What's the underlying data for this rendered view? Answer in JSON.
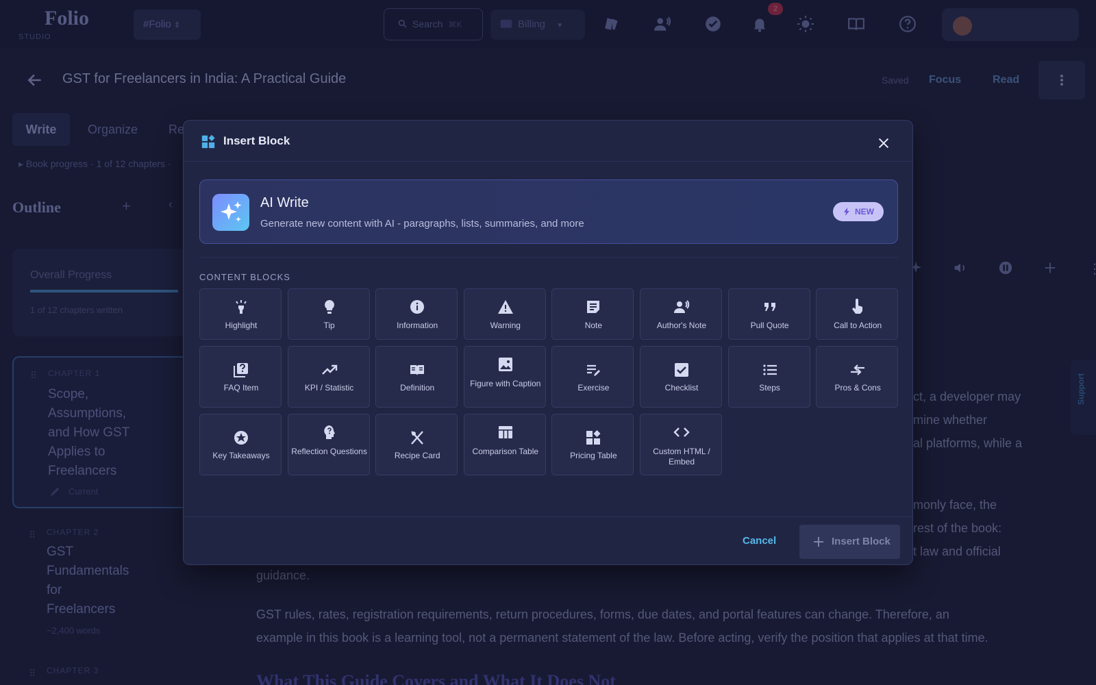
{
  "app": {
    "logo": "Folio",
    "logo_sub": "STUDIO",
    "workspace": "#Folio",
    "search_placeholder": "Search",
    "search_shortcut": "⌘K",
    "billing_label": "Billing",
    "notification_count": "2"
  },
  "doc": {
    "title": "GST for Freelancers in India: A Practical Guide",
    "saved": "Saved",
    "focus": "Focus",
    "read": "Read",
    "tabs": [
      "Write",
      "Organize",
      "Re"
    ],
    "book_progress": "▸ Book progress · 1 of 12 chapters ·"
  },
  "sidebar": {
    "outline_title": "Outline",
    "progress_label": "Overall Progress",
    "progress_fraction": 1.0,
    "progress_sub": "1 of 12 chapters written",
    "chapters": [
      {
        "kicker": "CHAPTER 1",
        "title": [
          "Scope,",
          "Assumptions,",
          "and How GST",
          "Applies to",
          "Freelancers"
        ],
        "meta": "Current"
      },
      {
        "kicker": "CHAPTER 2",
        "title": [
          "GST",
          "Fundamentals",
          "for",
          "Freelancers"
        ],
        "meta": "~2,400 words"
      },
      {
        "kicker": "CHAPTER 3",
        "title": [],
        "meta": ""
      }
    ]
  },
  "editor": {
    "frag1": "ct, a developer may",
    "frag2": "mine whether",
    "frag3": "al platforms, while a",
    "frag4": "monly face, the",
    "frag5": "rest of the book:",
    "frag6": "t law and official",
    "frag7": "guidance.",
    "para2_line1": "GST rules, rates, registration requirements, return procedures, forms, due dates, and portal features can change. Therefore, an",
    "para2_line2": "example in this book is a learning tool, not a permanent statement of the law. Before acting, verify the position that applies at that time.",
    "heading": "What This Guide Covers and What It Does Not",
    "support": "Support"
  },
  "modal": {
    "title": "Insert Block",
    "ai_title": "AI Write",
    "ai_desc": "Generate new content with AI - paragraphs, lists, summaries, and more",
    "new_badge": "NEW",
    "section_label": "CONTENT BLOCKS",
    "blocks": [
      {
        "label": "Highlight",
        "icon": "highlight-icon"
      },
      {
        "label": "Tip",
        "icon": "lightbulb-icon"
      },
      {
        "label": "Information",
        "icon": "info-icon"
      },
      {
        "label": "Warning",
        "icon": "warning-icon"
      },
      {
        "label": "Note",
        "icon": "note-icon"
      },
      {
        "label": "Author's Note",
        "icon": "speaker-icon"
      },
      {
        "label": "Pull Quote",
        "icon": "quote-icon"
      },
      {
        "label": "Call to Action",
        "icon": "pointer-icon"
      },
      {
        "label": "FAQ Item",
        "icon": "faq-icon"
      },
      {
        "label": "KPI / Statistic",
        "icon": "trend-icon"
      },
      {
        "label": "Definition",
        "icon": "book-icon"
      },
      {
        "label": "Figure with Caption",
        "icon": "image-icon"
      },
      {
        "label": "Exercise",
        "icon": "edit-list-icon"
      },
      {
        "label": "Checklist",
        "icon": "checkbox-icon"
      },
      {
        "label": "Steps",
        "icon": "list-icon"
      },
      {
        "label": "Pros & Cons",
        "icon": "compare-arrows-icon"
      },
      {
        "label": "Key Takeaways",
        "icon": "star-badge-icon"
      },
      {
        "label": "Reflection Questions",
        "icon": "head-question-icon"
      },
      {
        "label": "Recipe Card",
        "icon": "utensils-icon"
      },
      {
        "label": "Comparison Table",
        "icon": "table-icon"
      },
      {
        "label": "Pricing Table",
        "icon": "pricing-grid-icon"
      },
      {
        "label": "Custom HTML / Embed",
        "icon": "code-icon"
      }
    ],
    "cancel": "Cancel",
    "insert": "Insert Block"
  }
}
